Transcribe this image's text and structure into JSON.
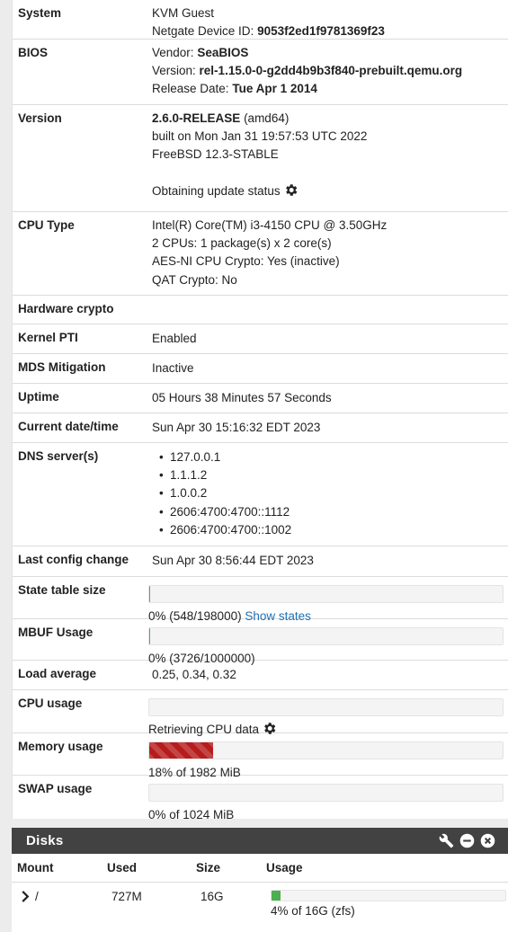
{
  "system": {
    "label": "System",
    "line1": "KVM Guest",
    "device_id_label": "Netgate Device ID:",
    "device_id": "9053f2ed1f9781369f23"
  },
  "bios": {
    "label": "BIOS",
    "vendor_label": "Vendor:",
    "vendor": "SeaBIOS",
    "version_label": "Version:",
    "version": "rel-1.15.0-0-g2dd4b9b3f840-prebuilt.qemu.org",
    "release_label": "Release Date:",
    "release": "Tue Apr 1 2014"
  },
  "version": {
    "label": "Version",
    "release": "2.6.0-RELEASE",
    "arch": "(amd64)",
    "built": "built on Mon Jan 31 19:57:53 UTC 2022",
    "os": "FreeBSD 12.3-STABLE",
    "update_status": "Obtaining update status",
    "update_icon": "gear-icon"
  },
  "cpu_type": {
    "label": "CPU Type",
    "model": "Intel(R) Core(TM) i3-4150 CPU @ 3.50GHz",
    "cores": "2 CPUs: 1 package(s) x 2 core(s)",
    "aesni": "AES-NI CPU Crypto: Yes (inactive)",
    "qat": "QAT Crypto: No"
  },
  "hardware_crypto": {
    "label": "Hardware crypto",
    "value": ""
  },
  "kernel_pti": {
    "label": "Kernel PTI",
    "value": "Enabled"
  },
  "mds": {
    "label": "MDS Mitigation",
    "value": "Inactive"
  },
  "uptime": {
    "label": "Uptime",
    "value": "05 Hours 38 Minutes 57 Seconds"
  },
  "datetime": {
    "label": "Current date/time",
    "value": "Sun Apr 30 15:16:32 EDT 2023"
  },
  "dns": {
    "label": "DNS server(s)",
    "servers": [
      "127.0.0.1",
      "1.1.1.2",
      "1.0.0.2",
      "2606:4700:4700::1112",
      "2606:4700:4700::1002"
    ]
  },
  "last_config": {
    "label": "Last config change",
    "value": "Sun Apr 30 8:56:44 EDT 2023"
  },
  "state_table": {
    "label": "State table size",
    "text": "0% (548/198000)",
    "link": "Show states",
    "fraction": 0.0028
  },
  "mbuf": {
    "label": "MBUF Usage",
    "text": "0% (3726/1000000)",
    "fraction": 0.0037
  },
  "load": {
    "label": "Load average",
    "value": "0.25, 0.34, 0.32"
  },
  "cpu_usage": {
    "label": "CPU usage",
    "text": "Retrieving CPU data",
    "fraction": 0
  },
  "memory": {
    "label": "Memory usage",
    "text": "18% of 1982 MiB",
    "fraction": 0.18,
    "color": "#b71c1c"
  },
  "swap": {
    "label": "SWAP usage",
    "text": "0% of 1024 MiB",
    "fraction": 0
  },
  "disks": {
    "title": "Disks",
    "columns": [
      "Mount",
      "Used",
      "Size",
      "Usage"
    ],
    "rows": [
      {
        "mount": "/",
        "used": "727M",
        "size": "16G",
        "usage_text": "4% of 16G (zfs)",
        "fraction": 0.04,
        "color": "#4caf50"
      }
    ]
  }
}
